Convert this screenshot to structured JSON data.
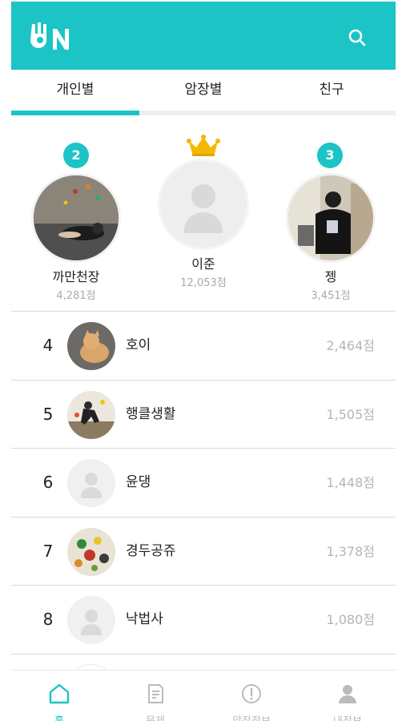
{
  "app": {
    "logo_text": "ON",
    "accent_color": "#1cc4c6"
  },
  "header": {
    "search_icon": "search-icon"
  },
  "tabs": [
    {
      "label": "개인별",
      "active": true
    },
    {
      "label": "암장별",
      "active": false
    },
    {
      "label": "친구",
      "active": false
    }
  ],
  "podium": {
    "first": {
      "rank": "1",
      "name": "이준",
      "score": "12,053점",
      "badge_icon": "crown-icon"
    },
    "second": {
      "rank": "2",
      "name": "까만천장",
      "score": "4,281점"
    },
    "third": {
      "rank": "3",
      "name": "젱",
      "score": "3,451점"
    }
  },
  "ranking": [
    {
      "rank": "4",
      "name": "호이",
      "score": "2,464점",
      "avatar": "cat-photo"
    },
    {
      "rank": "5",
      "name": "행클생활",
      "score": "1,505점",
      "avatar": "climber-photo"
    },
    {
      "rank": "6",
      "name": "윤댕",
      "score": "1,448점",
      "avatar": "default-avatar"
    },
    {
      "rank": "7",
      "name": "경두공쥬",
      "score": "1,378점",
      "avatar": "holds-photo"
    },
    {
      "rank": "8",
      "name": "낙법사",
      "score": "1,080점",
      "avatar": "default-avatar"
    }
  ],
  "bottom_nav": [
    {
      "label": "홈",
      "icon": "home-icon",
      "active": true
    },
    {
      "label": "문제",
      "icon": "document-icon",
      "active": false
    },
    {
      "label": "암장정보",
      "icon": "info-icon",
      "active": false
    },
    {
      "label": "내정보",
      "icon": "profile-icon",
      "active": false
    }
  ]
}
